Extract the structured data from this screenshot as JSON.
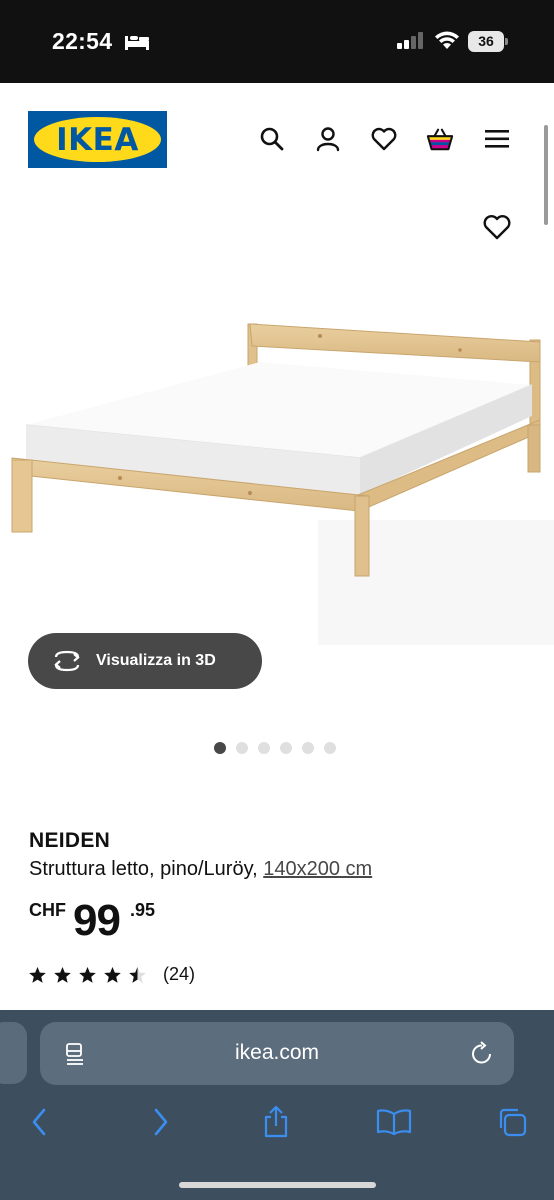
{
  "status_bar": {
    "time": "22:54",
    "battery": "36"
  },
  "header": {
    "logo_text": "IKEA",
    "brand_colors": {
      "blue": "#0058a3",
      "yellow": "#ffda1a"
    },
    "icons": [
      "search-icon",
      "account-icon",
      "heart-icon",
      "basket-icon",
      "menu-icon"
    ]
  },
  "gallery": {
    "view_3d_label": "Visualizza in 3D",
    "total_images": 6,
    "active_image": 1
  },
  "product": {
    "name": "NEIDEN",
    "description": "Struttura letto, pino/Luröy, ",
    "size": "140x200 cm",
    "price_currency": "CHF",
    "price_integer": "99",
    "price_decimal": ".95",
    "rating_value": 4.5,
    "rating_max": 5,
    "rating_count": "(24)"
  },
  "browser": {
    "url": "ikea.com"
  }
}
